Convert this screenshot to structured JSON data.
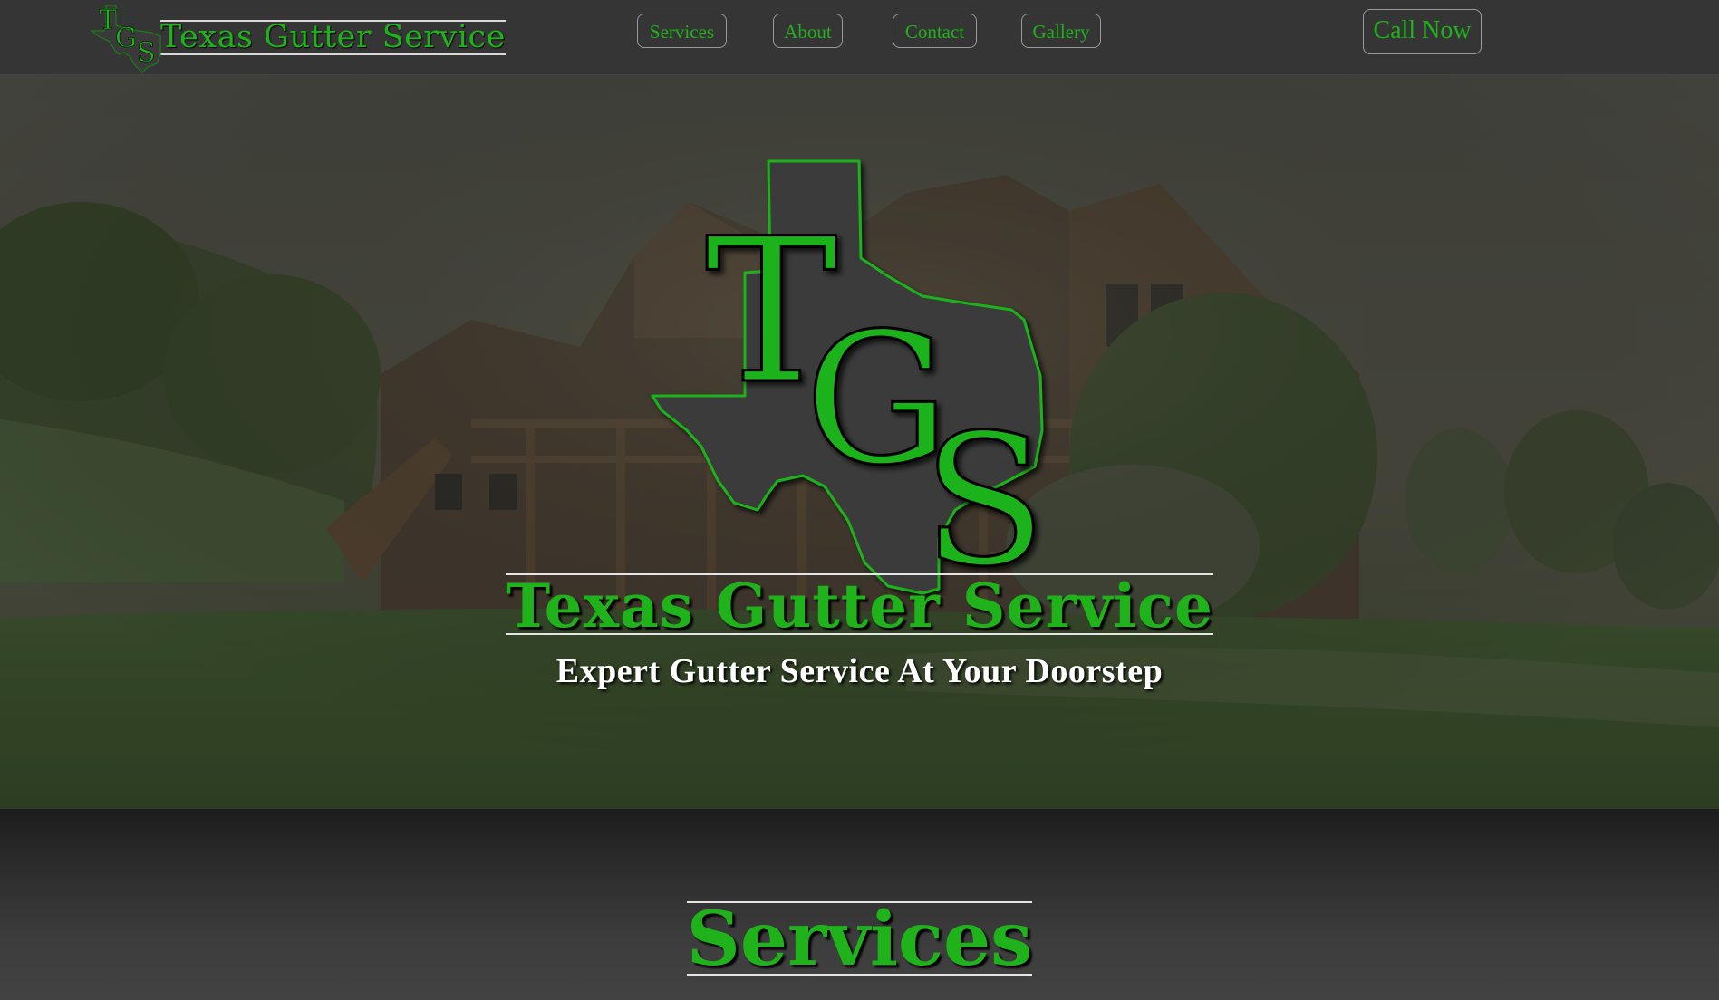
{
  "nav": {
    "logo_letters": [
      "T",
      "G",
      "S"
    ],
    "brand": "Texas Gutter Service",
    "links": [
      {
        "label": "Services"
      },
      {
        "label": "About"
      },
      {
        "label": "Contact"
      },
      {
        "label": "Gallery"
      }
    ],
    "cta": "Call Now"
  },
  "hero": {
    "logo_letters": [
      "T",
      "G",
      "S"
    ],
    "title": "Texas Gutter Service",
    "subtitle": "Expert Gutter Service At Your Doorstep",
    "background_image": "house-with-lawn-photo"
  },
  "services": {
    "heading": "Services"
  },
  "colors": {
    "accent_green": "#1fb21b",
    "nav_background": "#353535",
    "texas_shape": "#3a3a3a",
    "page_background": "#404040"
  }
}
